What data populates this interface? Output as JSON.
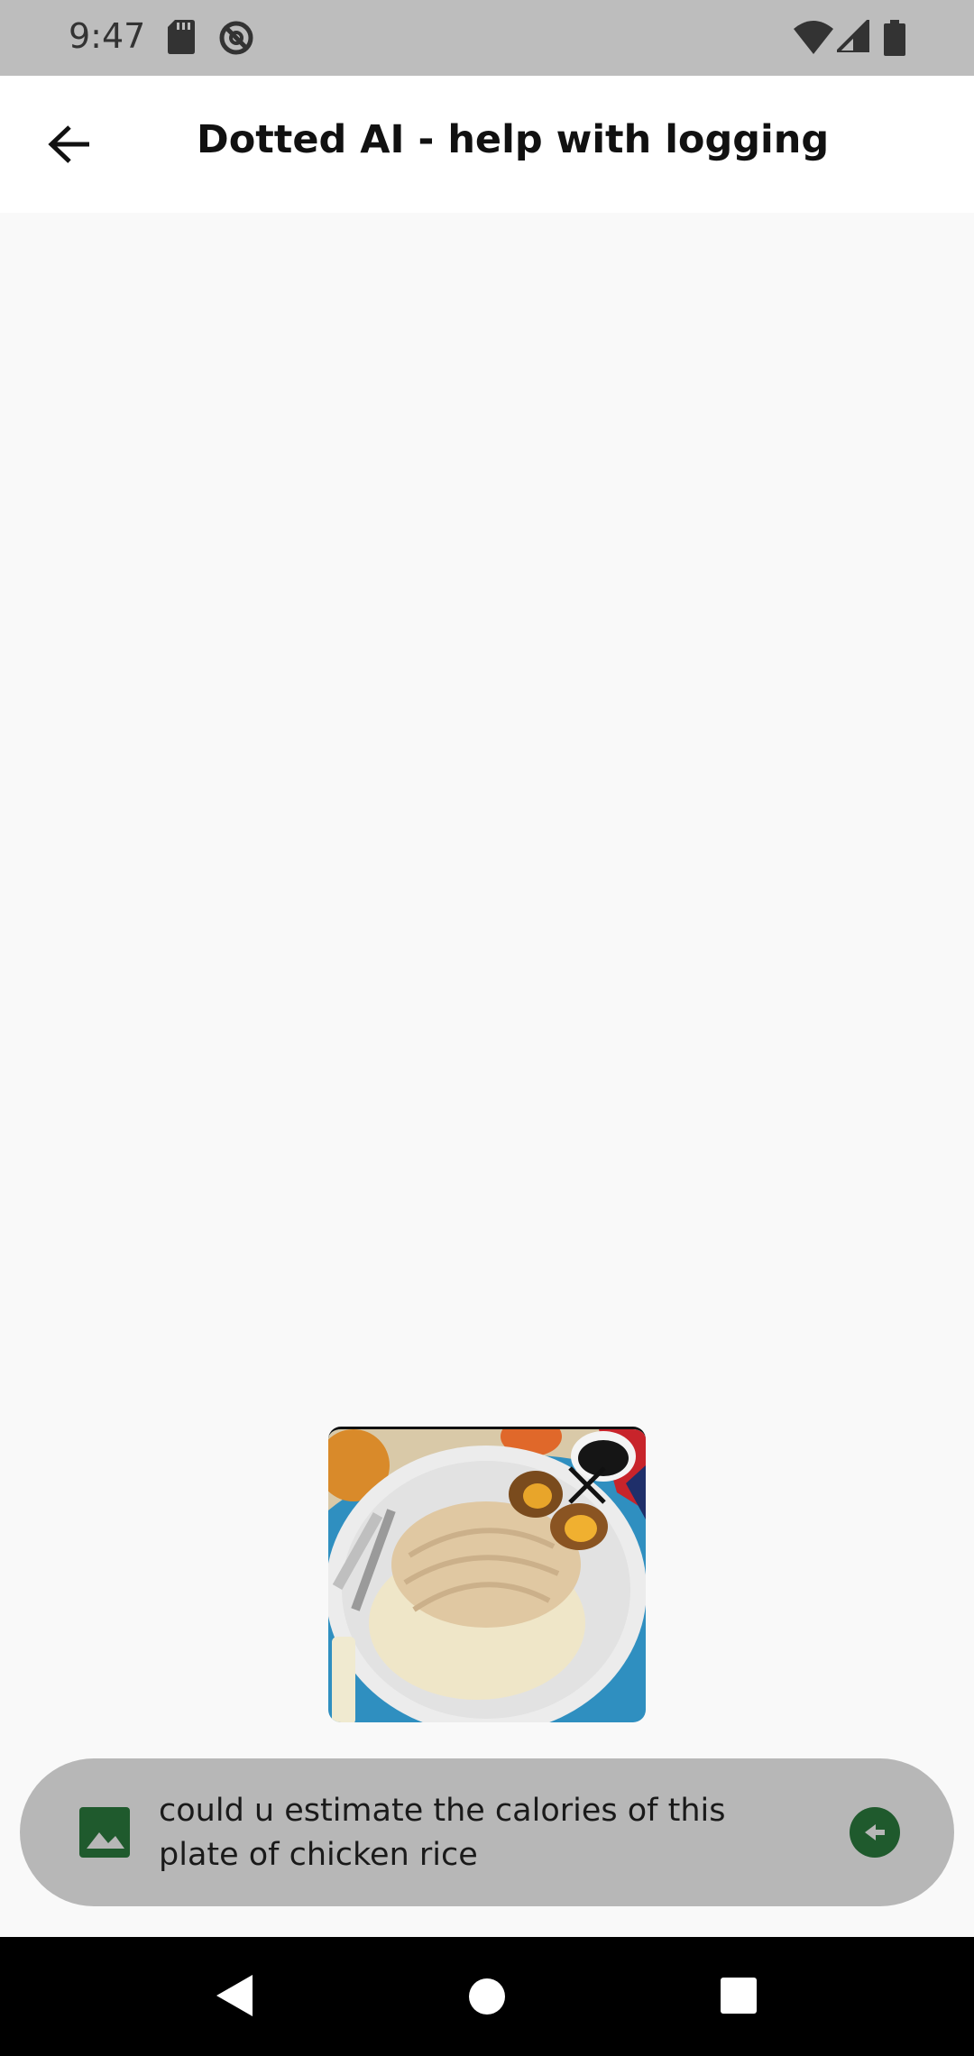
{
  "status_bar": {
    "time": "9:47",
    "icons": [
      "sd-card-icon",
      "blocked-icon",
      "wifi-icon",
      "signal-icon",
      "battery-icon"
    ]
  },
  "header": {
    "title": "Dotted AI - help with logging",
    "back_icon": "arrow-left-icon"
  },
  "attachment": {
    "image": "chicken-rice-photo",
    "remove_icon": "close-icon"
  },
  "composer": {
    "image_button_icon": "image-icon",
    "message": "could u estimate the calories of this plate of chicken rice",
    "send_icon": "send-arrow-icon"
  },
  "colors": {
    "accent": "#1f5a2d",
    "composer_bg": "#b7b7b7",
    "status_bar_bg": "#bdbdbd",
    "page_bg": "#f9f9f9"
  },
  "nav_bar": {
    "buttons": [
      "back-triangle-icon",
      "home-circle-icon",
      "recents-square-icon"
    ]
  }
}
